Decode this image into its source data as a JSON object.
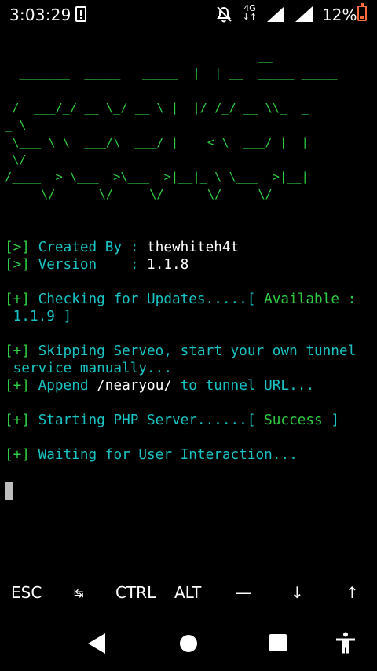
{
  "status_bar": {
    "time": "3:03:29",
    "network": "4G",
    "battery_percent": "12%",
    "icons": [
      "notification-icon",
      "dnd-off-icon",
      "signal-icon",
      "signal-icon",
      "battery-low-icon"
    ]
  },
  "terminal": {
    "banner_lines": [
      "                                   __",
      "  _______  _____   _____  |  | __  _____ _____",
      "__",
      " /  ___/_/ __ \\_/ __ \\ |  |/ /_/ __ \\\\_  _",
      "_ \\",
      " \\___ \\ \\  ___/\\  ___/ |    < \\  ___/ |  |",
      " \\/",
      "/____  > \\___  >\\___  >|__|_ \\ \\___  >|__|",
      "     \\/      \\/     \\/      \\/     \\/"
    ],
    "created_prefix": "[>]",
    "created_label": " Created By : ",
    "created_value": "thewhiteh4t",
    "version_prefix": "[>]",
    "version_label": " Version    : ",
    "version_value": "1.1.8",
    "updates_prefix": "[+]",
    "updates_label": " Checking for Updates.....[ ",
    "updates_status": "Available :",
    "updates_version": " 1.1.9 ]",
    "serveo_prefix": "[+]",
    "serveo_text_1": " Skipping Serveo, start your own tunnel",
    "serveo_text_2": " service manually...",
    "append_prefix": "[+]",
    "append_label": " Append ",
    "append_value": "/nearyou/",
    "append_suffix": " to tunnel URL...",
    "php_prefix": "[+]",
    "php_label": " Starting PHP Server......[ ",
    "php_status": "Success",
    "php_close": " ]",
    "waiting_prefix": "[+]",
    "waiting_text": " Waiting for User Interaction..."
  },
  "extra_keys": {
    "esc": "ESC",
    "tab": "↹",
    "ctrl": "CTRL",
    "alt": "ALT",
    "dash": "—",
    "down": "↓",
    "up": "↑"
  },
  "colors": {
    "green": "#2ecc40",
    "cyan": "#19c3c3",
    "background": "#000000"
  }
}
